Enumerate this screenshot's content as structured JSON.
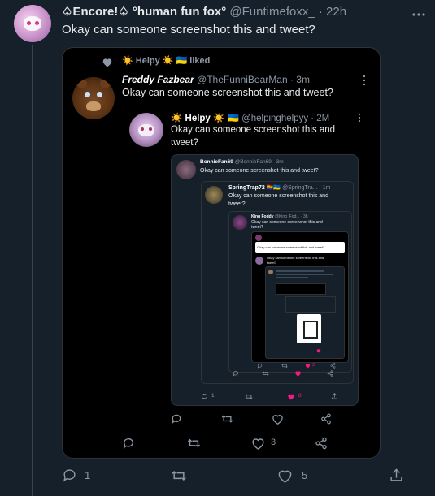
{
  "tweet": {
    "name": "♤Encore!♤ °human fun fox°",
    "handle": "@Funtimefoxx_",
    "time": "· 22h",
    "text": "Okay can someone screenshot this and tweet?",
    "actions": {
      "reply": "1",
      "retweet": "",
      "like": "5"
    }
  },
  "shot1": {
    "liked_line": "☀️ Helpy ☀️ 🇺🇦 liked",
    "name": "Freddy Fazbear",
    "handle": "@TheFunniBearMan · 3m",
    "text": "Okay can someone screenshot this and tweet?",
    "like_count": "3"
  },
  "shot2": {
    "name": "☀️ Helpy ☀️ 🇺🇦",
    "handle": "@helpinghelpyy · 2M",
    "text_line1": "Okay can someone screenshot this and",
    "text_line2": "tweet?"
  },
  "shot3": {
    "name": "BonnieFan69",
    "handle": "@BonnieFan69 · 3m",
    "text": "Okay can someone screenshot this and tweet?",
    "reply_count": "1",
    "like_count": "8"
  },
  "shot4": {
    "name": "SpringTrap72 🏳️‍🌈🇺🇦",
    "handle": "@SpringTra... · 1m",
    "text_line1": "Okay can someone screenshot this and",
    "text_line2": "tweet?"
  },
  "shot5": {
    "name": "King Foddy",
    "handle": "@King_Fod... · 3h",
    "text_line1": "Okay can someone screenshot this and",
    "text_line2": "tweet?",
    "inner_text": "Okay can someone screenshot this and tweet?",
    "inner_text2_line1": "Okay can someone screenshot this and",
    "inner_text2_line2": "tweet?",
    "like_count": "3"
  },
  "colors": {
    "bg": "#15202b",
    "like": "#f91880",
    "text": "#e7e9ea",
    "muted": "#8b98a5"
  }
}
